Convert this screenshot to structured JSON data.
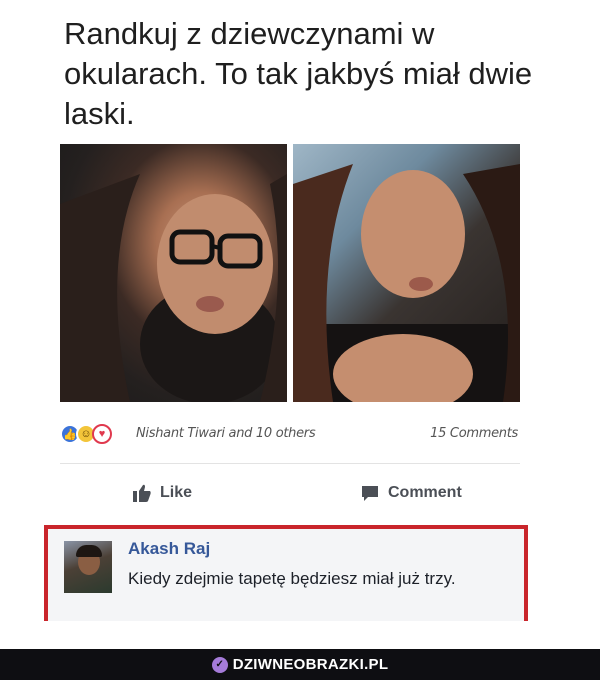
{
  "meme": {
    "caption": "Randkuj z dziewczynami w okularach. To tak jakbyś miał dwie laski."
  },
  "post": {
    "reactions": [
      "like-icon",
      "haha-icon",
      "love-icon"
    ],
    "reactors_text": "Nishant Tiwari and 10 others",
    "comments_count": "15 Comments",
    "actions": {
      "like_label": "Like",
      "comment_label": "Comment"
    }
  },
  "comment": {
    "author": "Akash Raj",
    "text": "Kiedy zdejmie tapetę będziesz miał już trzy."
  },
  "footer": {
    "brand": "DZIWNEOBRAZKI.PL"
  },
  "colors": {
    "like_blue": "#3b73d9",
    "author_blue": "#365899",
    "highlight_red": "#c9252b",
    "footer_bg": "#0e0e12",
    "brand_accent": "#a57bd9"
  }
}
